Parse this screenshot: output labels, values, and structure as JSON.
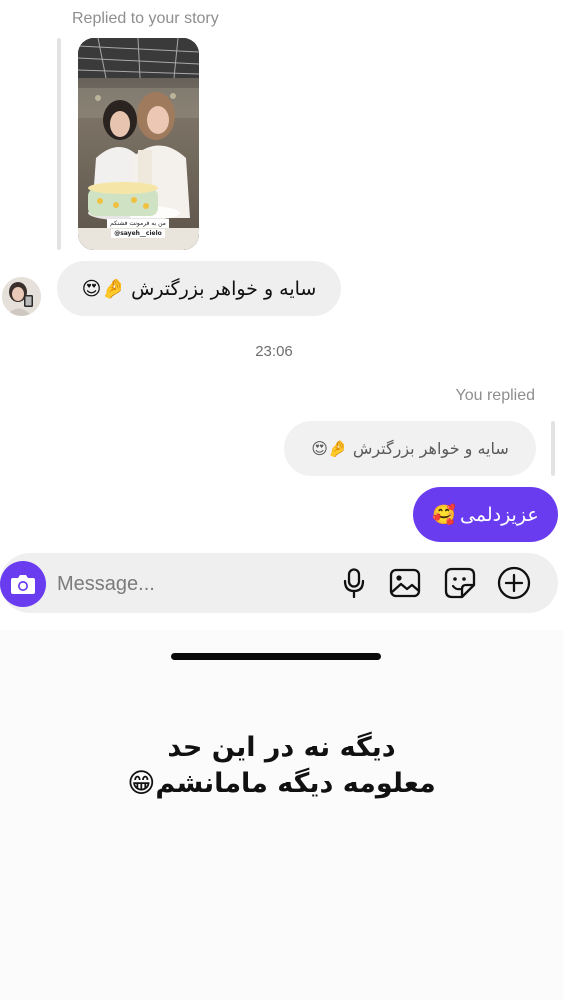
{
  "chat": {
    "replied_to_story_label": "Replied to your story",
    "story": {
      "caption_line1": "من به فرمونت فشنكم",
      "caption_line2": "@sayeh__cielo"
    },
    "incoming_message": {
      "text": "سایه و خواهر بزرگترش",
      "emoji": "🤌😍"
    },
    "timestamp": "23:06",
    "you_replied_label": "You replied",
    "quoted_message": {
      "text": "سایه و خواهر بزرگترش",
      "emoji": "🤌😍"
    },
    "outgoing_message": {
      "text": "عزیزدلمی",
      "emoji": "🥰"
    }
  },
  "composer": {
    "placeholder": "Message...",
    "icons": [
      "camera-icon",
      "microphone-icon",
      "gallery-icon",
      "sticker-icon",
      "add-icon"
    ]
  },
  "overlay": {
    "line1": "دیگه نه در این حد",
    "line2": "معلومه دیگه مامانشم",
    "emoji": "😁"
  },
  "colors": {
    "accent": "#6a3cf0",
    "bubble_gray": "#efeff0",
    "secondary_text": "#8e8e8e"
  }
}
